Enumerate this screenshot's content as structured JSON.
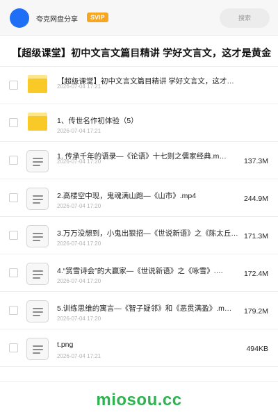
{
  "header": {
    "user_name": "夸克网盘分享",
    "vip_label": "SVIP",
    "search_placeholder": "搜索"
  },
  "share": {
    "title": "【超级课堂】初中文言文篇目精讲 学好文言文，这才是黄金"
  },
  "files": [
    {
      "type": "folder",
      "name": "【超级课堂】初中文言文篇目精讲 学好文言文，这才…",
      "date": "2026-07-04 17:21",
      "size": ""
    },
    {
      "type": "folder",
      "name": "1、传世名作初体验（5）",
      "date": "2026-07-04 17:21",
      "size": ""
    },
    {
      "type": "file",
      "name": "1. 传承千年的语录—《论语》十七则之儒家经典.m…",
      "date": "2026-07-04 17:20",
      "size": "137.3M"
    },
    {
      "type": "file",
      "name": "2.高楼空中现，鬼魂满山跑—《山市》.mp4",
      "date": "2026-07-04 17:20",
      "size": "244.9M"
    },
    {
      "type": "file",
      "name": "3.万万没想到，小鬼出狠招—《世说新语》之《陈太丘…",
      "date": "2026-07-04 17:20",
      "size": "171.3M"
    },
    {
      "type": "file",
      "name": "4.“赏雪诗会”的大赢家—《世说新语》之《咏雪》.…",
      "date": "2026-07-04 17:20",
      "size": "172.4M"
    },
    {
      "type": "file",
      "name": "5.训练思维的寓言—《智子疑邻》和《恶贯满盈》.m…",
      "date": "2026-07-04 17:20",
      "size": "179.2M"
    },
    {
      "type": "file",
      "name": "t.png",
      "date": "2026-07-04 17:21",
      "size": "494KB"
    }
  ],
  "watermark": "miosou.cc",
  "colors": {
    "accent": "#1e6ff5",
    "vip": "#f5a623",
    "folder": "#f9c927",
    "watermark": "#2fb351"
  }
}
